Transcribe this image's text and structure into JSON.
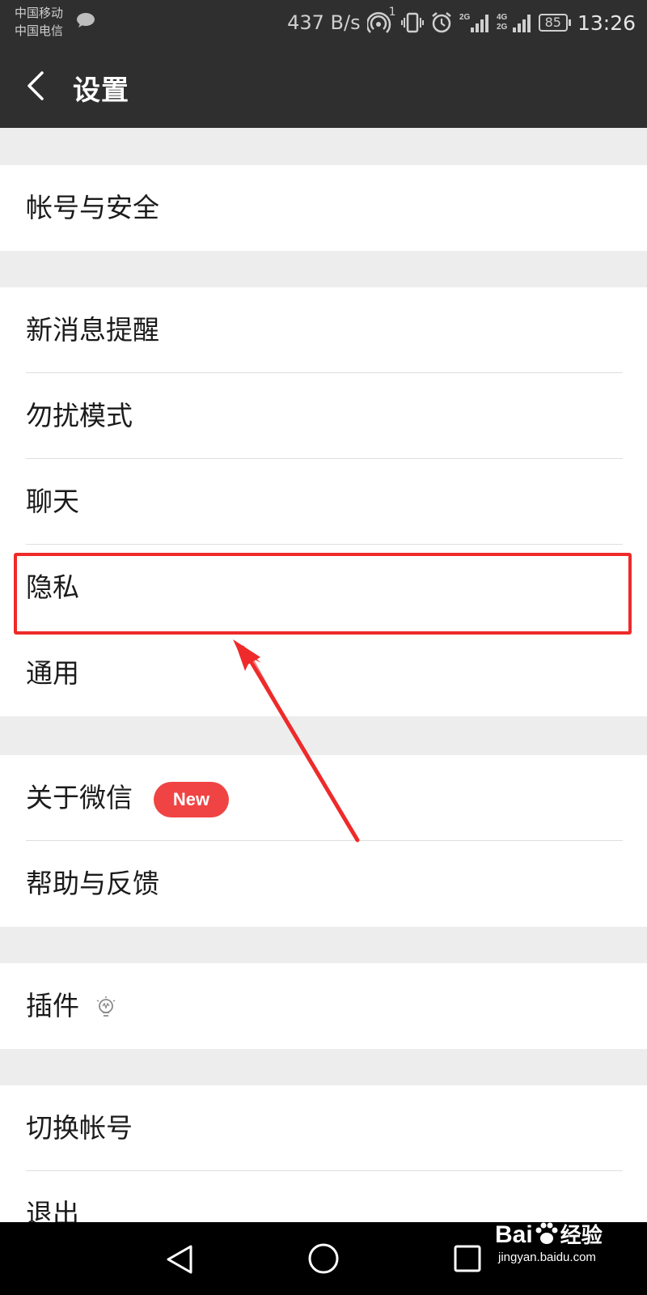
{
  "status_bar": {
    "carrier_1": "中国移动",
    "carrier_2": "中国电信",
    "net_speed": "437 B/s",
    "hotspot_sup": "1",
    "battery": "85",
    "time": "13:26",
    "icons": [
      "chat-bubble-icon",
      "hotspot-icon",
      "vibrate-icon",
      "alarm-icon",
      "signal-2g-icon",
      "signal-4g-2g-icon"
    ]
  },
  "header": {
    "title": "设置",
    "back_icon": "chevron-left-icon"
  },
  "settings": {
    "account_security": "帐号与安全",
    "new_message_alert": "新消息提醒",
    "do_not_disturb": "勿扰模式",
    "chat": "聊天",
    "privacy": "隐私",
    "general": "通用",
    "about_wechat": "关于微信",
    "about_badge": "New",
    "help_feedback": "帮助与反馈",
    "plugins": "插件",
    "plugins_icon": "lightbulb-icon",
    "switch_account": "切换帐号",
    "logout": "退出"
  },
  "annotation": {
    "color": "#ee2a2a",
    "highlighted_item": "隐私"
  },
  "nav_bar": {
    "icons": [
      "back-triangle-icon",
      "home-circle-icon",
      "recents-square-icon"
    ]
  },
  "watermark": {
    "brand": "Bai",
    "brand_tail": "经验",
    "url": "jingyan.baidu.com"
  },
  "colors": {
    "header_bg": "#2f2f2f",
    "page_bg": "#ededed",
    "badge": "#f04444"
  }
}
